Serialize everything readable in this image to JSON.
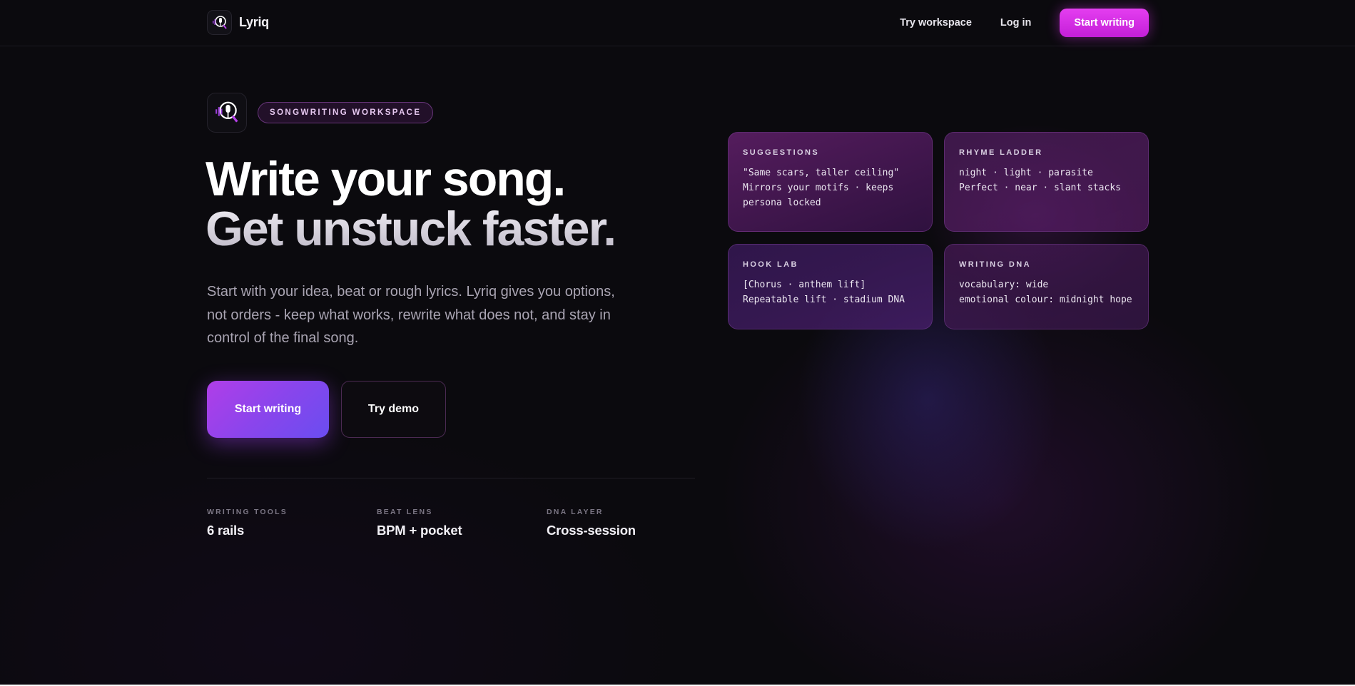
{
  "nav": {
    "brand": "Lyriq",
    "links": [
      "Try workspace",
      "Log in"
    ],
    "cta": "Start writing"
  },
  "hero": {
    "badge": "SONGWRITING WORKSPACE",
    "headline_line1": "Write your song.",
    "headline_line2": "Get unstuck faster.",
    "lede": "Start with your idea, beat or rough lyrics. Lyriq gives you options, not orders - keep what works, rewrite what does not, and stay in control of the final song.",
    "primary_button": "Start writing",
    "secondary_button": "Try demo"
  },
  "stats": [
    {
      "label": "WRITING TOOLS",
      "value": "6 rails"
    },
    {
      "label": "BEAT LENS",
      "value": "BPM + pocket"
    },
    {
      "label": "DNA LAYER",
      "value": "Cross-session"
    }
  ],
  "cards": [
    {
      "title": "SUGGESTIONS",
      "lines": [
        "\"Same scars, taller ceiling\"",
        "Mirrors your motifs · keeps",
        "persona locked"
      ]
    },
    {
      "title": "RHYME LADDER",
      "lines": [
        "night · light · parasite",
        "Perfect · near · slant stacks"
      ]
    },
    {
      "title": "HOOK LAB",
      "lines": [
        "[Chorus · anthem lift]",
        "Repeatable lift · stadium DNA"
      ]
    },
    {
      "title": "WRITING DNA",
      "lines": [
        "vocabulary: wide",
        "emotional colour: midnight hope"
      ]
    }
  ],
  "colors": {
    "background": "#0b0a0e",
    "accent": "#d62ee6",
    "primary_gradient_start": "#b03ee8",
    "primary_gradient_end": "#6a4df0"
  },
  "icons": {
    "logo": "microphone-q-icon"
  }
}
